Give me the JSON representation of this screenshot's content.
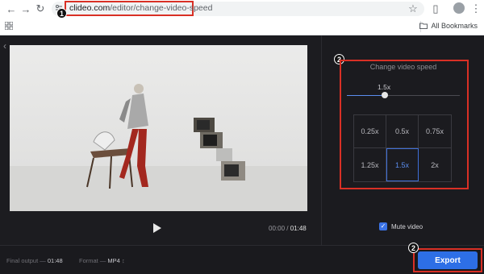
{
  "browser": {
    "url_domain": "clideo.com",
    "url_path": "/editor/change-video-speed",
    "bookmarks_label": "All Bookmarks"
  },
  "annotations": {
    "step1": "1",
    "step2": "2",
    "step3": "2"
  },
  "player": {
    "time_current": "00:00",
    "time_separator": " / ",
    "time_duration": "01:48"
  },
  "speed_panel": {
    "title": "Change video speed",
    "current_value": "1.5x",
    "slider_fraction": 0.33,
    "options": [
      "0.25x",
      "0.5x",
      "0.75x",
      "1.25x",
      "1.5x",
      "2x"
    ],
    "selected": "1.5x"
  },
  "mute": {
    "label": "Mute video",
    "checked": true
  },
  "footer": {
    "final_output_label": "Final output — ",
    "final_output_value": "01:48",
    "format_label": "Format — ",
    "format_value": "MP4",
    "export_label": "Export"
  },
  "colors": {
    "accent": "#2d6fe6",
    "highlight": "#d93025"
  }
}
